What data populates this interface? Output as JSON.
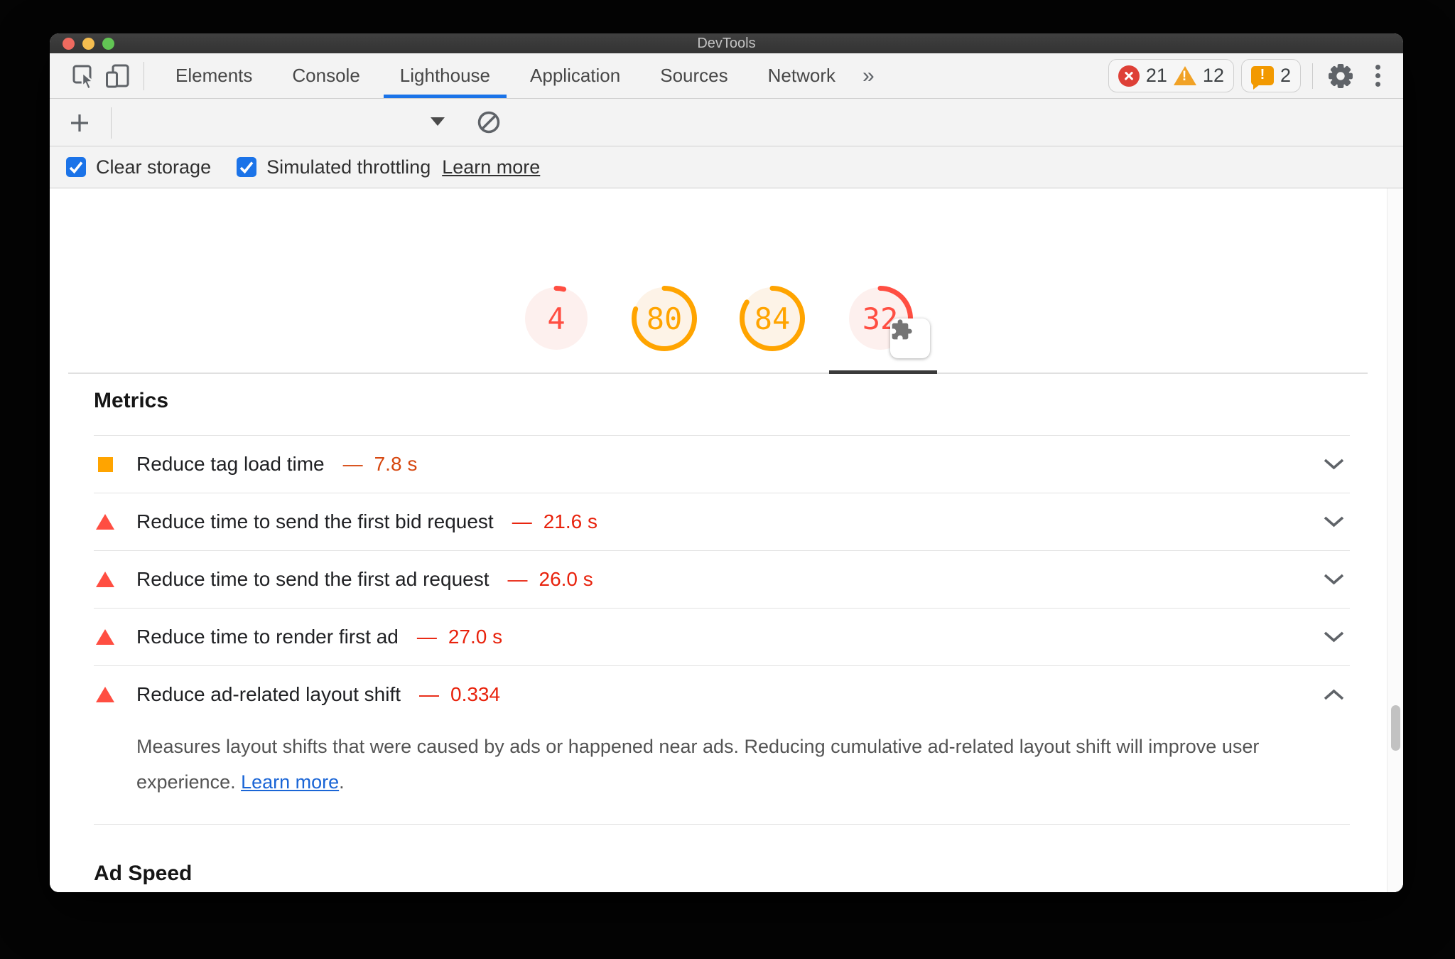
{
  "window": {
    "title": "DevTools"
  },
  "toolbar": {
    "tabs": [
      "Elements",
      "Console",
      "Lighthouse",
      "Application",
      "Sources",
      "Network"
    ],
    "selected_tab": "Lighthouse",
    "overflow_chevron": "»",
    "error_count": "21",
    "warning_count": "12",
    "issue_count": "2"
  },
  "settings_bar": {
    "clear_storage_label": "Clear storage",
    "throttling_label": "Simulated throttling",
    "learn_more_label": "Learn more"
  },
  "lighthouse": {
    "gauges": [
      {
        "score": "4",
        "percent": 4,
        "color": "#ff4e42",
        "bg": "#fdf0ee",
        "has_plugin_badge": false
      },
      {
        "score": "80",
        "percent": 80,
        "color": "#ffa400",
        "bg": "#fdf3e7",
        "has_plugin_badge": false
      },
      {
        "score": "84",
        "percent": 84,
        "color": "#ffa400",
        "bg": "#fdf3e7",
        "has_plugin_badge": false
      },
      {
        "score": "32",
        "percent": 32,
        "color": "#ff4e42",
        "bg": "#fdf0ee",
        "has_plugin_badge": true
      }
    ],
    "metrics_heading": "Metrics",
    "audits": [
      {
        "icon": "square",
        "icon_color": "#ffa400",
        "title": "Reduce tag load time",
        "separator": "—",
        "value": "7.8 s",
        "value_color": "#d6470f",
        "expanded": false
      },
      {
        "icon": "triangle",
        "icon_color": "#ff4e42",
        "title": "Reduce time to send the first bid request",
        "separator": "—",
        "value": "21.6 s",
        "value_color": "#e8220c",
        "expanded": false
      },
      {
        "icon": "triangle",
        "icon_color": "#ff4e42",
        "title": "Reduce time to send the first ad request",
        "separator": "—",
        "value": "26.0 s",
        "value_color": "#e8220c",
        "expanded": false
      },
      {
        "icon": "triangle",
        "icon_color": "#ff4e42",
        "title": "Reduce time to render first ad",
        "separator": "—",
        "value": "27.0 s",
        "value_color": "#e8220c",
        "expanded": false
      },
      {
        "icon": "triangle",
        "icon_color": "#ff4e42",
        "title": "Reduce ad-related layout shift",
        "separator": "—",
        "value": "0.334",
        "value_color": "#e8220c",
        "expanded": true,
        "description": "Measures layout shifts that were caused by ads or happened near ads. Reducing cumulative ad-related layout shift will improve user experience.",
        "learn_more_label": "Learn more",
        "period": "."
      }
    ],
    "ad_speed_heading": "Ad Speed"
  },
  "colors": {
    "accent_blue": "#1a73e8",
    "fail_red": "#ff4e42",
    "average_orange": "#ffa400",
    "error_badge": "#de4037",
    "warning_badge": "#f1a226",
    "issues_badge": "#f29900"
  }
}
